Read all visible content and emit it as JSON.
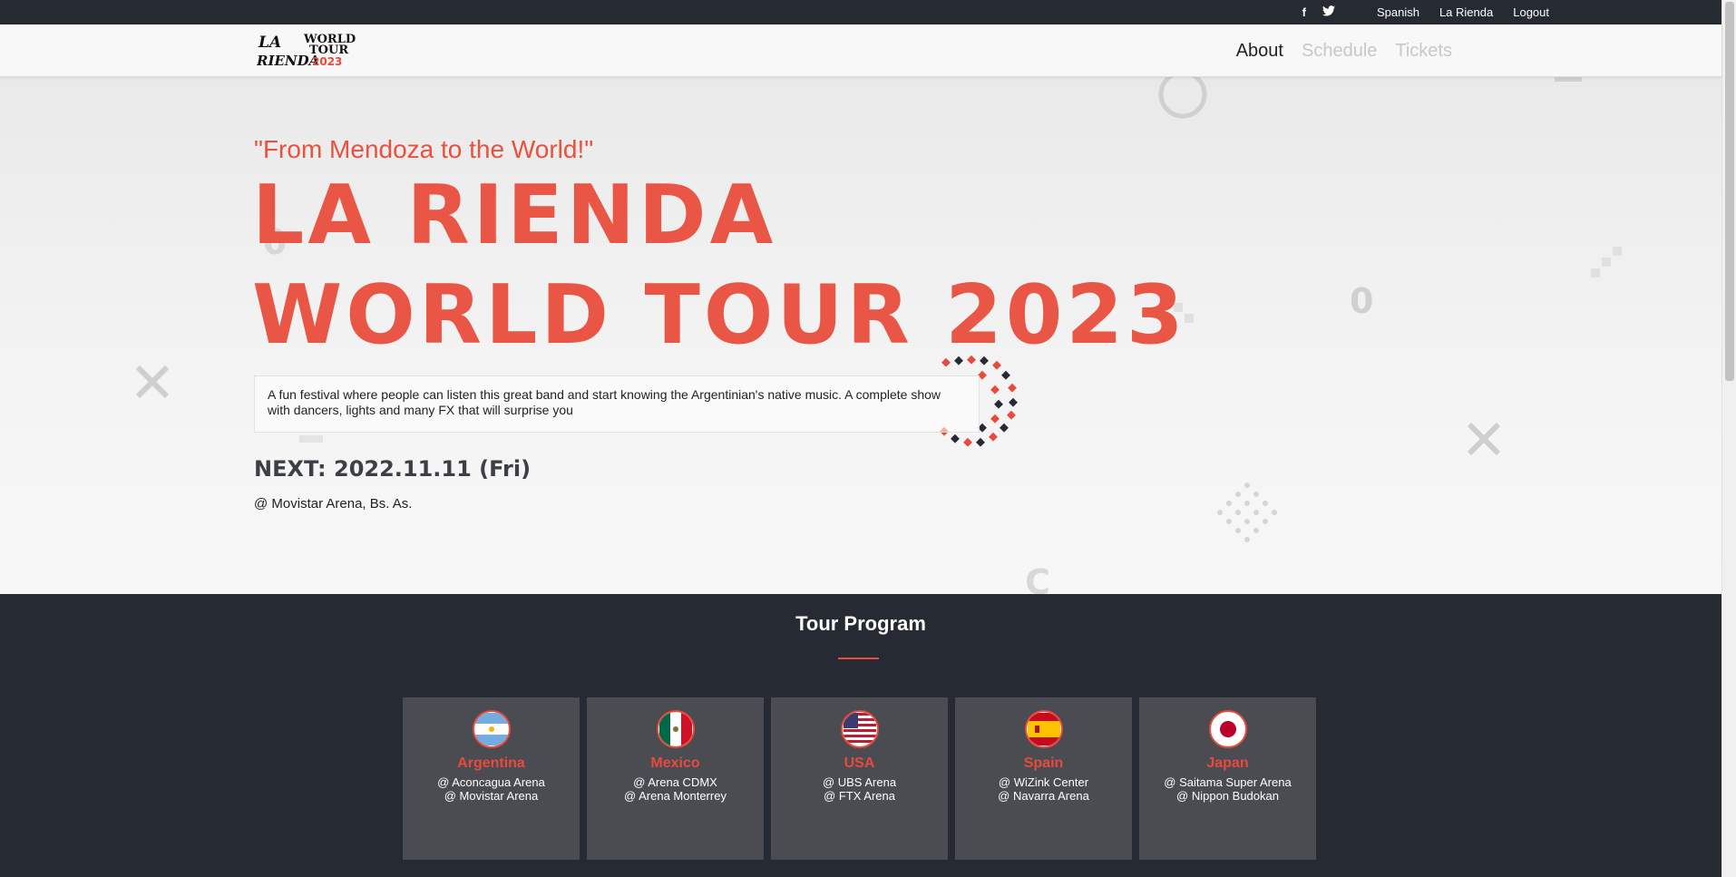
{
  "topbar": {
    "social": [
      {
        "name": "facebook-icon",
        "glyph": "f"
      },
      {
        "name": "twitter-icon",
        "glyph": "🐦"
      }
    ],
    "links": [
      "Spanish",
      "La Rienda",
      "Logout"
    ]
  },
  "logo": {
    "line1": "LA RIENDA",
    "line2": "WORLD TOUR",
    "line3": "2023"
  },
  "nav": {
    "items": [
      "About",
      "Schedule",
      "Tickets"
    ],
    "active": "About"
  },
  "hero": {
    "tagline": "\"From Mendoza to the World!\"",
    "title_line1": "LA RIENDA",
    "title_line2": "WORLD TOUR 2023",
    "description": "A fun festival where people can listen this great band and start knowing the Argentinian's native music. A complete show with dancers, lights and many FX that will surprise you",
    "next": "NEXT: 2022.11.11 (Fri)",
    "venue": "@ Movistar Arena, Bs. As."
  },
  "program": {
    "title": "Tour Program",
    "cards": [
      {
        "country": "Argentina",
        "flag": "argentina-flag-icon",
        "venue1": "@ Aconcagua Arena",
        "venue2": "@ Movistar Arena"
      },
      {
        "country": "Mexico",
        "flag": "mexico-flag-icon",
        "venue1": "@ Arena CDMX",
        "venue2": "@ Arena Monterrey"
      },
      {
        "country": "USA",
        "flag": "usa-flag-icon",
        "venue1": "@ UBS Arena",
        "venue2": "@ FTX Arena"
      },
      {
        "country": "Spain",
        "flag": "spain-flag-icon",
        "venue1": "@ WiZink Center",
        "venue2": "@ Navarra Arena"
      },
      {
        "country": "Japan",
        "flag": "japan-flag-icon",
        "venue1": "@ Saitama Super Arena",
        "venue2": "@ Nippon Budokan"
      }
    ]
  },
  "colors": {
    "accent": "#e84a3c",
    "dark": "#262a33",
    "card": "#4a4c52"
  }
}
